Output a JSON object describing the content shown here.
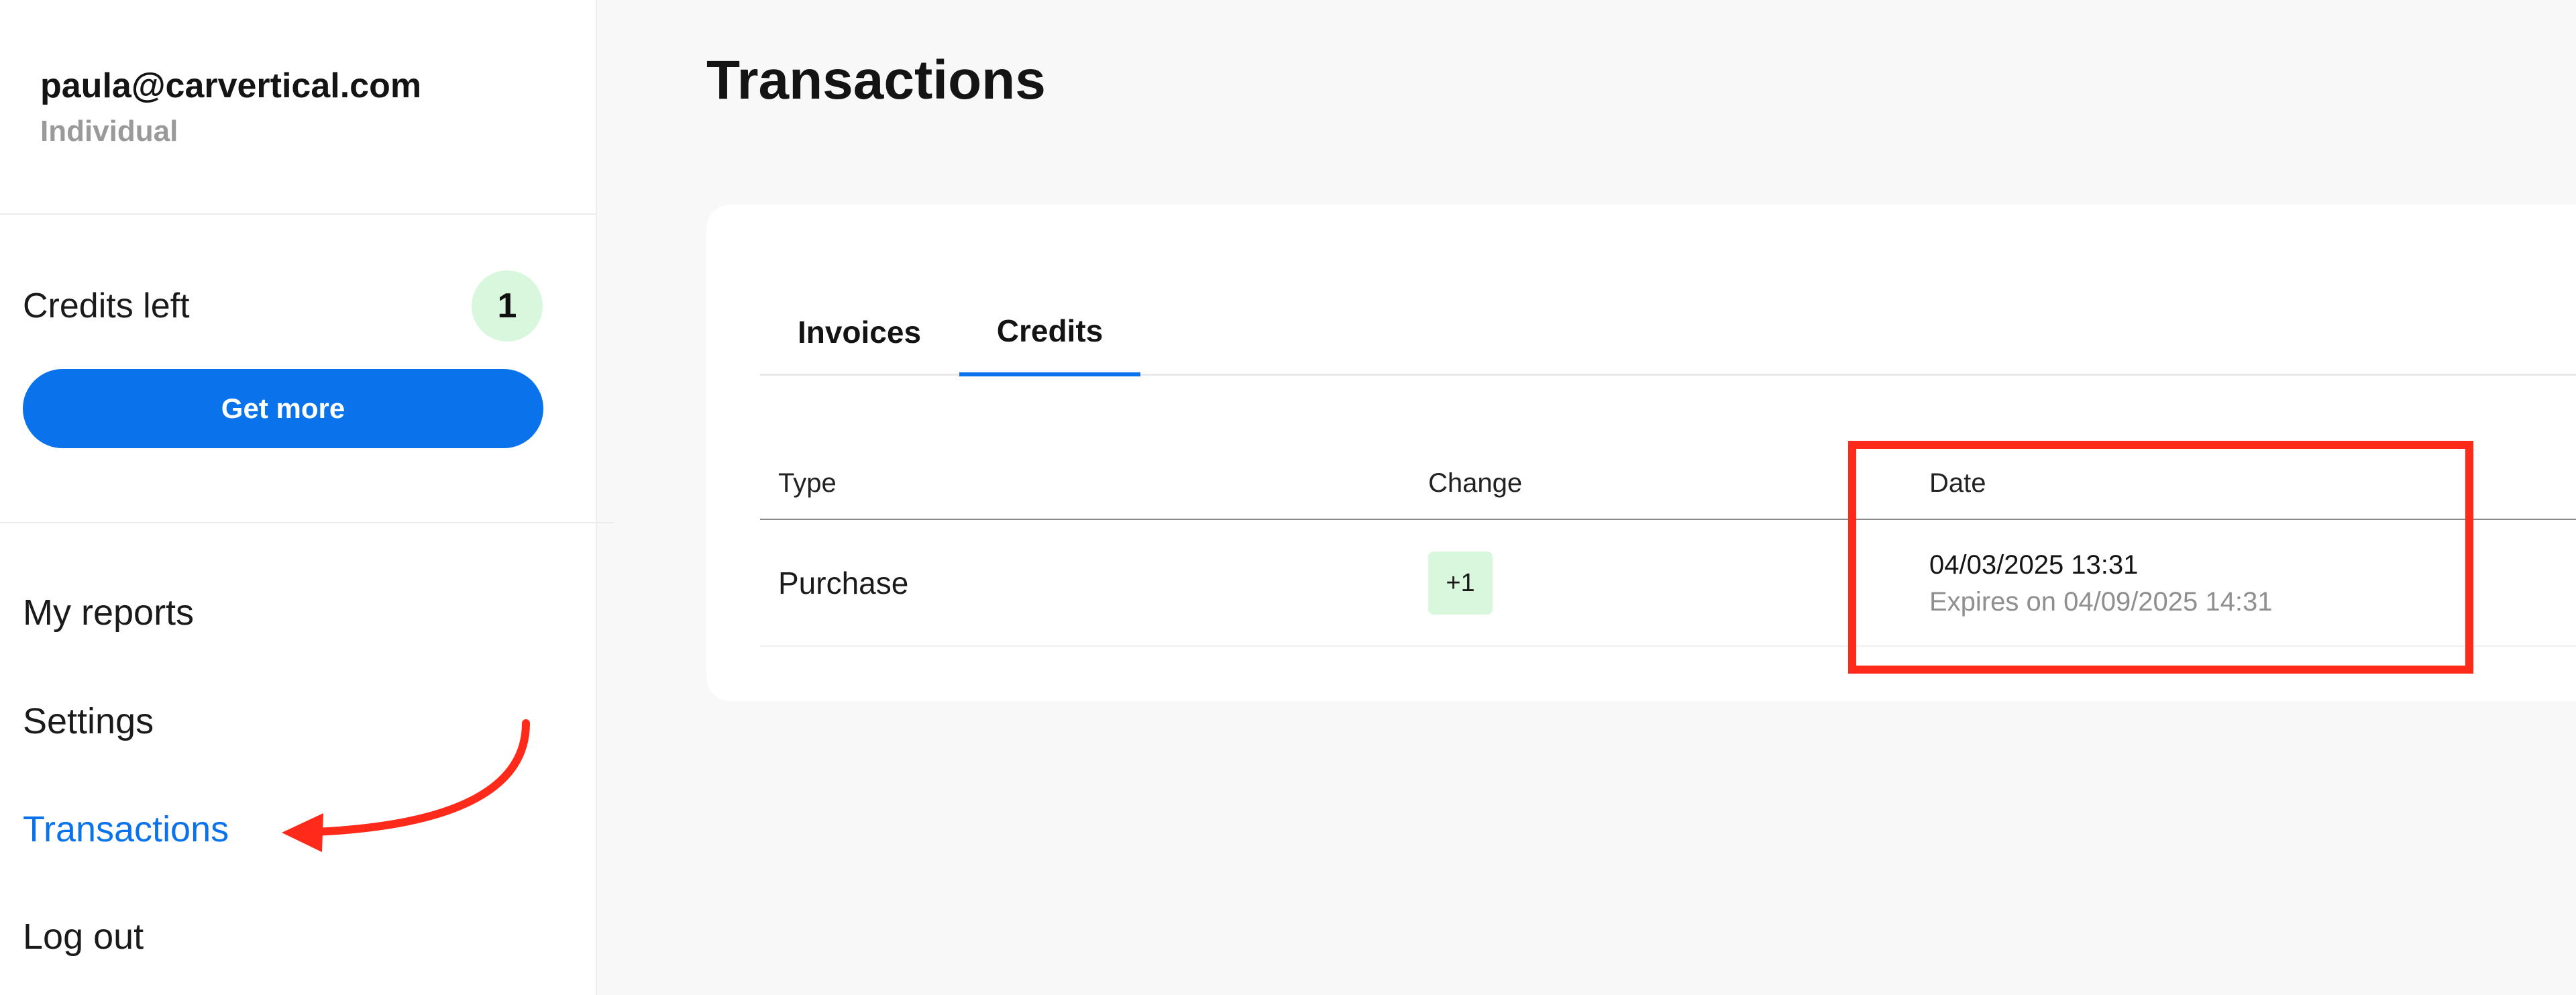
{
  "account": {
    "email": "paula@carvertical.com",
    "type": "Individual"
  },
  "credits": {
    "label": "Credits left",
    "count": "1",
    "get_more_label": "Get more"
  },
  "nav": {
    "items": [
      {
        "label": "My reports"
      },
      {
        "label": "Settings"
      },
      {
        "label": "Transactions",
        "active": true
      },
      {
        "label": "Log out"
      }
    ]
  },
  "main": {
    "title": "Transactions",
    "tabs": [
      {
        "label": "Invoices"
      },
      {
        "label": "Credits",
        "active": true
      }
    ],
    "table": {
      "columns": [
        "Type",
        "Change",
        "Date"
      ],
      "rows": [
        {
          "type": "Purchase",
          "change": "+1",
          "date": "04/03/2025 13:31",
          "expires": "Expires on 04/09/2025 14:31"
        }
      ]
    }
  },
  "colors": {
    "accent": "#0a73eb",
    "badge_bg": "#d8f7dc",
    "annotation": "#ff2a1a"
  }
}
